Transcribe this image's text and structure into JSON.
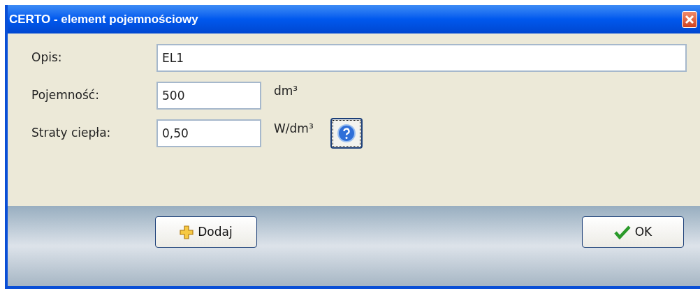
{
  "window": {
    "title": "CERTO - element pojemnościowy"
  },
  "fields": [
    {
      "label": "Opis:",
      "value": "EL1",
      "kind": "wide"
    },
    {
      "label": "Pojemność:",
      "value": "500",
      "unit": "dm³",
      "kind": "short"
    },
    {
      "label": "Straty ciepła:",
      "value": "0,50",
      "unit": "W/dm³",
      "kind": "short",
      "help": true
    }
  ],
  "buttons": [
    {
      "label": "Dodaj",
      "kind": "add"
    },
    {
      "label": "OK",
      "kind": "ok"
    }
  ]
}
